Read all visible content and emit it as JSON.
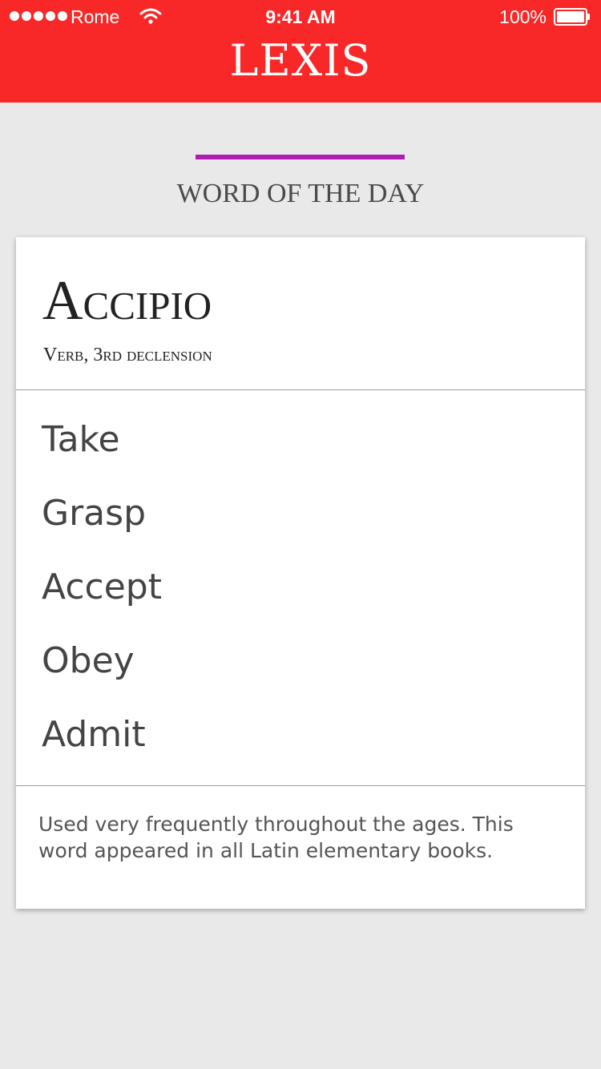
{
  "status_bar": {
    "carrier": "Rome",
    "time": "9:41 AM",
    "battery_percent": "100%",
    "signal_icon": "signal-dots-icon",
    "wifi_icon": "wifi-icon",
    "battery_icon": "battery-icon"
  },
  "header": {
    "title": "LEXIS",
    "background_color": "#f82828"
  },
  "section": {
    "title": "WORD OF THE DAY",
    "accent_color": "#b01cb0"
  },
  "card": {
    "word": "Accipio",
    "part_of_speech": "Verb, 3rd declension",
    "meanings": [
      "Take",
      "Grasp",
      "Accept",
      "Obey",
      "Admit"
    ],
    "note": "Used very frequently throughout the ages. This word appeared in all Latin elementary books."
  }
}
